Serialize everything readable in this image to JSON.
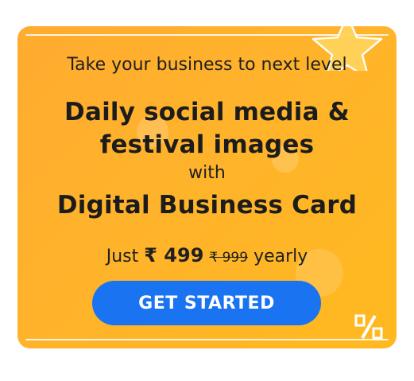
{
  "banner": {
    "tagline": "Take your business to next level",
    "headline_line1": "Daily social media &",
    "headline_line2": "festival images",
    "connector": "with",
    "headline_line3": "Digital Business Card",
    "price_prefix": "Just",
    "price_new": "₹ 499",
    "price_old": "₹ 999",
    "price_suffix": "yearly",
    "cta_label": "GET STARTED"
  },
  "colors": {
    "background": "#ffb32b",
    "button": "#1a73f0",
    "text": "#1c1c1c"
  },
  "icons": [
    "star-icon",
    "percent-icon"
  ]
}
